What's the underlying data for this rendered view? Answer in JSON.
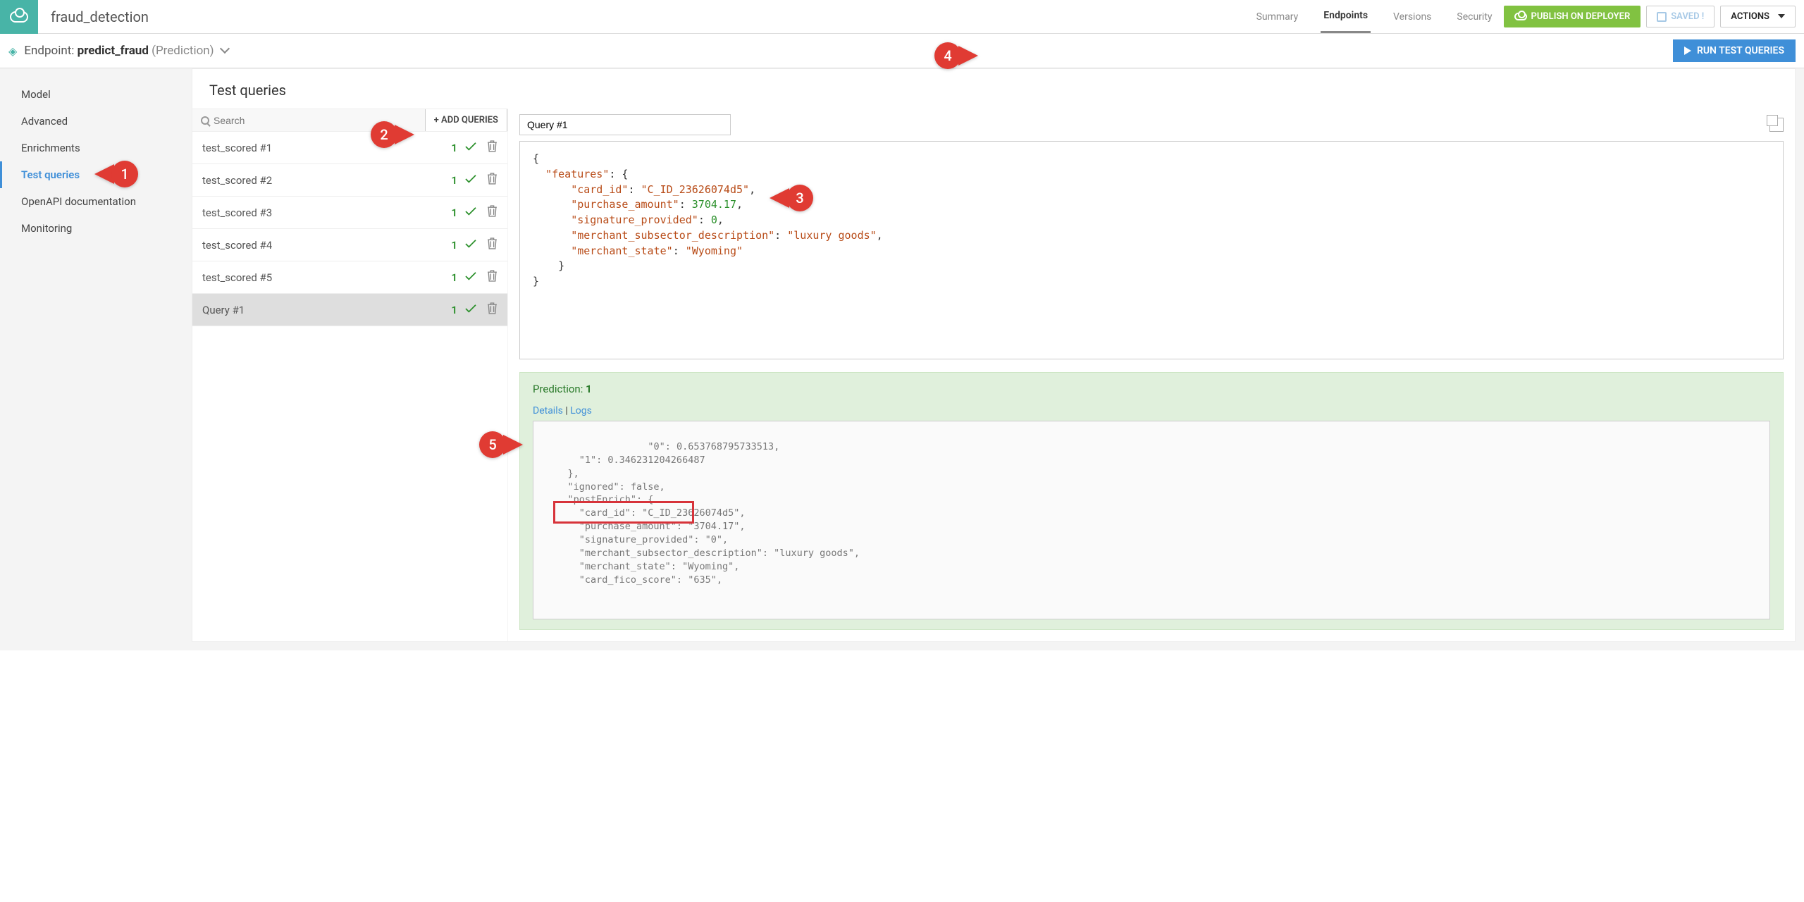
{
  "header": {
    "title": "fraud_detection",
    "tabs": [
      "Summary",
      "Endpoints",
      "Versions",
      "Security"
    ],
    "active_tab": 1,
    "publish_label": "PUBLISH ON DEPLOYER",
    "saved_label": "SAVED !",
    "actions_label": "ACTIONS"
  },
  "subheader": {
    "prefix": "Endpoint:",
    "name": "predict_fraud",
    "paren": "(Prediction)",
    "run_label": "RUN TEST QUERIES"
  },
  "sidebar": {
    "items": [
      "Model",
      "Advanced",
      "Enrichments",
      "Test queries",
      "OpenAPI documentation",
      "Monitoring"
    ],
    "active": 3
  },
  "main": {
    "title": "Test queries",
    "search_placeholder": "Search",
    "add_label": "+ ADD QUERIES",
    "queries": [
      {
        "name": "test_scored #1",
        "count": "1"
      },
      {
        "name": "test_scored #2",
        "count": "1"
      },
      {
        "name": "test_scored #3",
        "count": "1"
      },
      {
        "name": "test_scored #4",
        "count": "1"
      },
      {
        "name": "test_scored #5",
        "count": "1"
      },
      {
        "name": "Query #1",
        "count": "1"
      }
    ],
    "selected": 5
  },
  "detail": {
    "query_name": "Query #1",
    "json_lines": [
      {
        "t": "{"
      },
      {
        "t": "  \"features\": {"
      },
      {
        "t": "      \"card_id\": ",
        "v_str": "\"C_ID_23626074d5\"",
        "tail": ","
      },
      {
        "t": "      \"purchase_amount\": ",
        "v_num": "3704.17",
        "tail": ","
      },
      {
        "t": "      \"signature_provided\": ",
        "v_num": "0",
        "tail": ","
      },
      {
        "t": "      \"merchant_subsector_description\": ",
        "v_str": "\"luxury goods\"",
        "tail": ","
      },
      {
        "t": "      \"merchant_state\": ",
        "v_str": "\"Wyoming\""
      },
      {
        "t": "    }"
      },
      {
        "t": "}"
      }
    ],
    "prediction_label": "Prediction:",
    "prediction_value": "1",
    "details_label": "Details",
    "logs_label": "Logs",
    "result_text": "      \"0\": 0.653768795733513,\n      \"1\": 0.346231204266487\n    },\n    \"ignored\": false,\n    \"postEnrich\": {\n      \"card_id\": \"C_ID_23626074d5\",\n      \"purchase_amount\": \"3704.17\",\n      \"signature_provided\": \"0\",\n      \"merchant_subsector_description\": \"luxury goods\",\n      \"merchant_state\": \"Wyoming\",\n      \"card_fico_score\": \"635\","
  },
  "callouts": {
    "c1": "1",
    "c2": "2",
    "c3": "3",
    "c4": "4",
    "c5": "5"
  }
}
